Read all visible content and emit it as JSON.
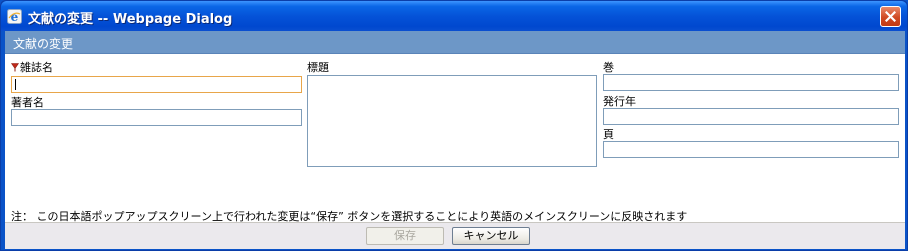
{
  "window": {
    "title": "文献の変更 -- Webpage Dialog"
  },
  "subheader": {
    "title": "文献の変更"
  },
  "form": {
    "journal_label": "雑誌名",
    "journal_value": "",
    "author_label": "著者名",
    "author_value": "",
    "title_label": "標題",
    "title_value": "",
    "volume_label": "巻",
    "volume_value": "",
    "year_label": "発行年",
    "year_value": "",
    "page_label": "頁",
    "page_value": ""
  },
  "note": "注：  この日本語ポップアップスクリーン上で行われた変更は“保存” ボタンを選択することにより英語のメインスクリーンに反映されます",
  "buttons": {
    "save_label": "保存",
    "cancel_label": "キャンセル"
  },
  "colors": {
    "titlebar": "#0553d8",
    "subheader": "#6d97c7",
    "focus_border": "#e8a64a",
    "required_marker": "#c0281a",
    "close_button": "#d04a23"
  },
  "icons": {
    "app": "ie-icon",
    "close": "close-icon",
    "required": "required-flag-icon"
  }
}
